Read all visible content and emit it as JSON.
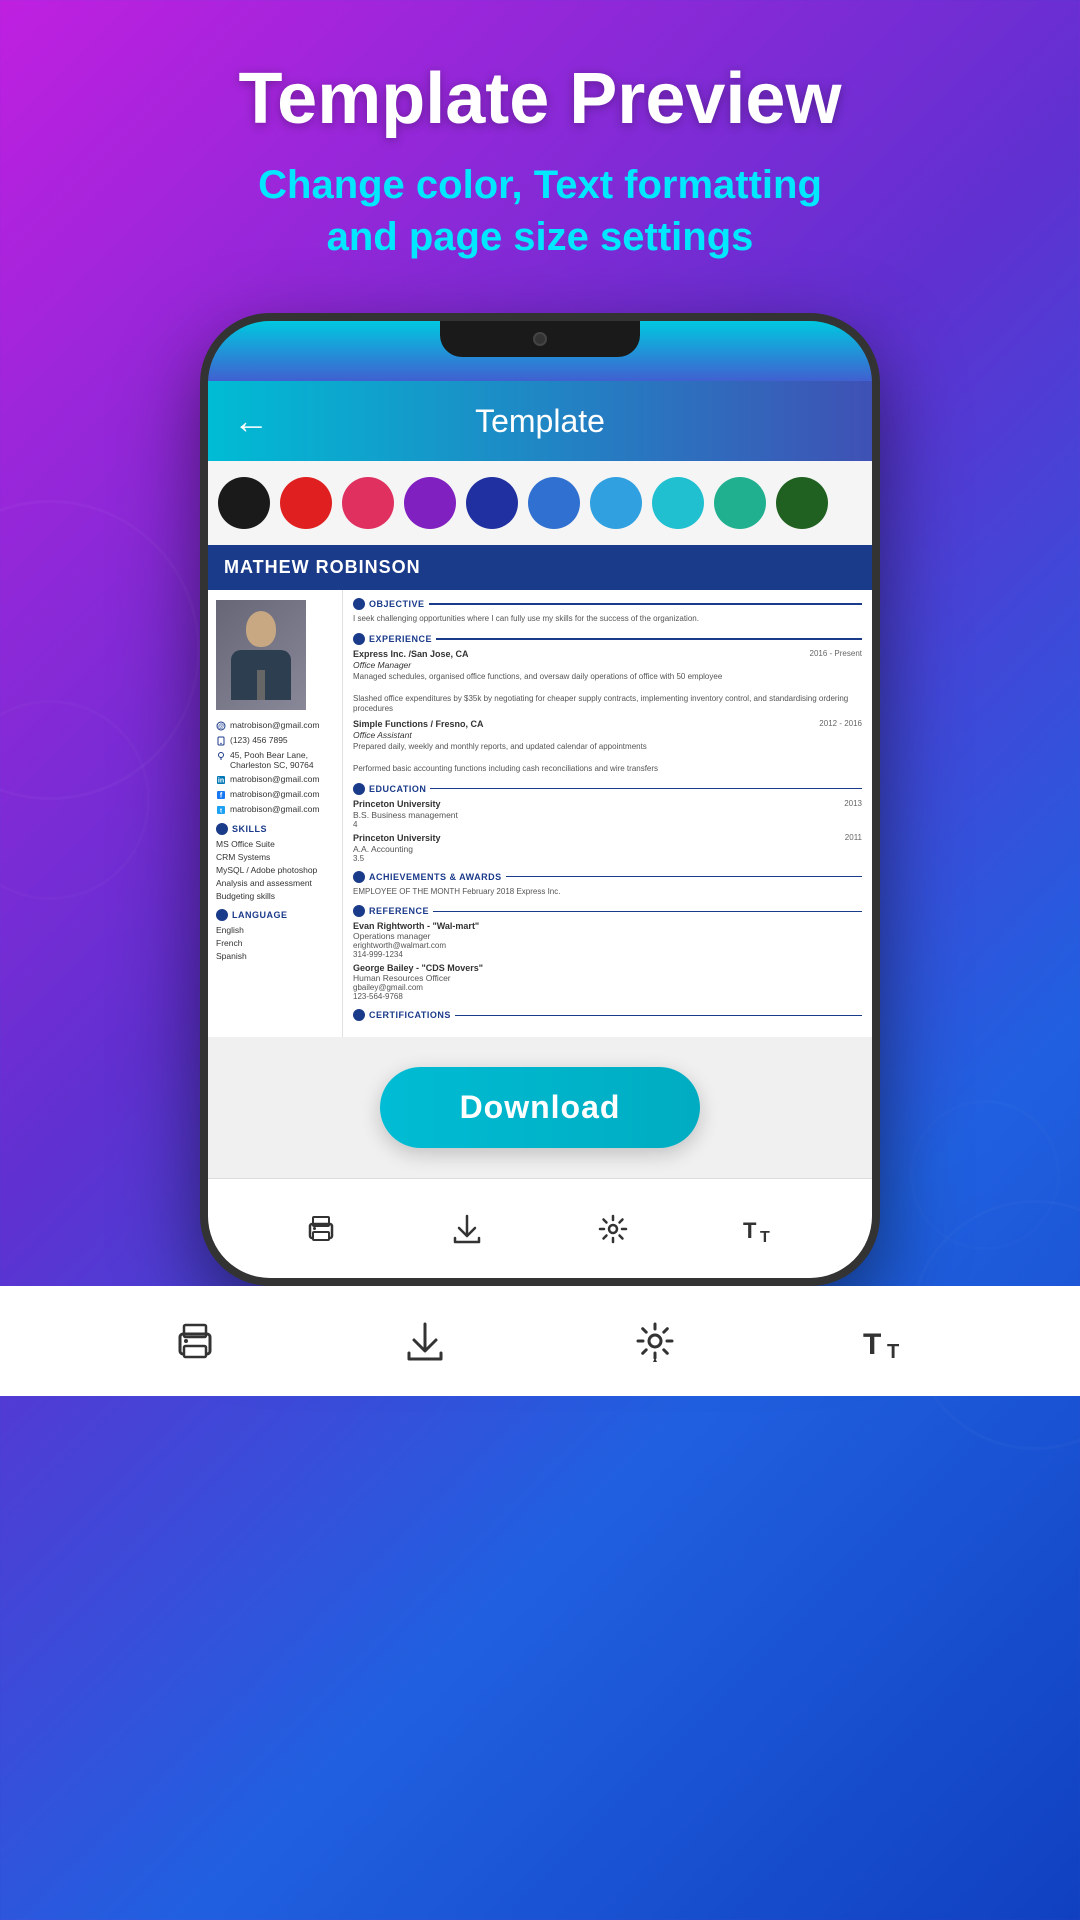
{
  "header": {
    "title": "Template Preview",
    "subtitle": "Change color, Text formatting\nand page size settings"
  },
  "app": {
    "back_icon": "←",
    "screen_title": "Template"
  },
  "colors": [
    {
      "name": "black",
      "hex": "#1a1a1a"
    },
    {
      "name": "red",
      "hex": "#e02020"
    },
    {
      "name": "pink",
      "hex": "#e03060"
    },
    {
      "name": "purple",
      "hex": "#8020c0"
    },
    {
      "name": "dark-blue",
      "hex": "#2030a0"
    },
    {
      "name": "blue",
      "hex": "#3070d0"
    },
    {
      "name": "sky-blue",
      "hex": "#30a0e0"
    },
    {
      "name": "cyan",
      "hex": "#20c0d0"
    },
    {
      "name": "teal",
      "hex": "#20b090"
    },
    {
      "name": "green",
      "hex": "#206020"
    }
  ],
  "resume": {
    "name": "MATHEW ROBINSON",
    "photo_alt": "Profile photo",
    "contact": {
      "email": "matrobison@gmail.com",
      "phone": "(123) 456 7895",
      "address": "45, Pooh Bear Lane, Charleston SC, 90764",
      "linkedin": "matrobison@gmail.com",
      "facebook": "matrobison@gmail.com",
      "twitter": "matrobison@gmail.com"
    },
    "skills": {
      "section_title": "SKILLS",
      "items": [
        "MS Office Suite",
        "CRM Systems",
        "MySQL / Adobe photoshop",
        "Analysis and assessment",
        "Budgeting skills"
      ]
    },
    "language": {
      "section_title": "LANGUAGE",
      "items": [
        "English",
        "French",
        "Spanish"
      ]
    },
    "objective": {
      "section_title": "OBJECTIVE",
      "text": "I seek challenging opportunities where I can fully use my skills for the success of the organization."
    },
    "experience": {
      "section_title": "EXPERIENCE",
      "items": [
        {
          "company": "Express Inc. /San Jose, CA",
          "date": "2016 - Present",
          "role": "Office Manager",
          "desc": "Managed schedules, organised office functions, and oversaw daily operations of office with 50 employee\n\nSlashed office expenditures by $35k by negotiating for cheaper supply contracts, implementing inventory control, and standardising ordering procedures"
        },
        {
          "company": "Simple Functions / Fresno, CA",
          "date": "2012 - 2016",
          "role": "Office Assistant",
          "desc": "Prepared daily, weekly and monthly reports, and updated calendar of appointments\n\nPerformed basic accounting functions including cash reconciliations and wire transfers"
        }
      ]
    },
    "education": {
      "section_title": "EDUCATION",
      "items": [
        {
          "school": "Princeton University",
          "date": "2013",
          "degree": "B.S. Business management",
          "gpa": "4"
        },
        {
          "school": "Princeton University",
          "date": "2011",
          "degree": "A.A. Accounting",
          "gpa": "3.5"
        }
      ]
    },
    "achievements": {
      "section_title": "ACHIEVEMENTS & AWARDS",
      "text": "EMPLOYEE OF THE MONTH February 2018 Express Inc."
    },
    "reference": {
      "section_title": "REFERENCE",
      "items": [
        {
          "name": "Evan Rightworth - \"Wal-mart\"",
          "role": "Operations manager",
          "email": "erightworth@walmart.com",
          "phone": "314-999-1234"
        },
        {
          "name": "George Bailey - \"CDS Movers\"",
          "role": "Human Resources Officer",
          "email": "gbailey@gmail.com",
          "phone": "123-564-9768"
        }
      ]
    },
    "certifications": {
      "section_title": "CERTIFICATIONS"
    }
  },
  "download_button": "Download",
  "bottom_nav": {
    "icons": [
      {
        "name": "print-icon",
        "label": "Print"
      },
      {
        "name": "download-icon",
        "label": "Download"
      },
      {
        "name": "settings-icon",
        "label": "Settings"
      },
      {
        "name": "text-size-icon",
        "label": "Text Size"
      }
    ]
  }
}
